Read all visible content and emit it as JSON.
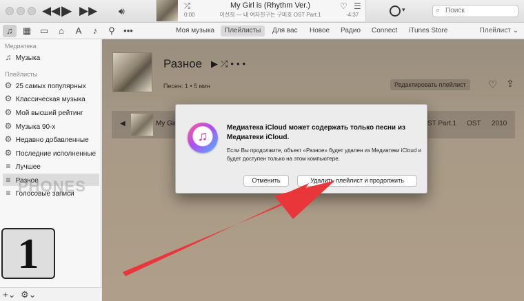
{
  "player": {
    "prev_icon": "rewind-icon",
    "play_icon": "play-icon",
    "next_icon": "fast-forward-icon",
    "volume_icon": "volume-icon",
    "now_playing": {
      "title": "My Girl is (Rhythm Ver.)",
      "artist_line": "이선희 — 내 여자친구는 구미호 OST Part.1",
      "elapsed": "0:00",
      "remaining": "-4:37",
      "progress_fraction": 0.0
    }
  },
  "search": {
    "placeholder": "Поиск"
  },
  "nav": {
    "tabs": [
      {
        "label": "Моя музыка"
      },
      {
        "label": "Плейлисты"
      },
      {
        "label": "Для вас"
      },
      {
        "label": "Новое"
      },
      {
        "label": "Радио"
      },
      {
        "label": "Connect"
      },
      {
        "label": "iTunes Store"
      }
    ],
    "active_tab": "Плейлисты",
    "view_select": "Плейлист"
  },
  "sidebar": {
    "library_header": "Медиатека",
    "library_items": [
      {
        "label": "Музыка",
        "icon": "music-note-icon"
      }
    ],
    "playlists_header": "Плейлисты",
    "playlist_items": [
      {
        "label": "25 самых популярных",
        "icon": "gear-icon"
      },
      {
        "label": "Классическая музыка",
        "icon": "gear-icon"
      },
      {
        "label": "Мой высший рейтинг",
        "icon": "gear-icon"
      },
      {
        "label": "Музыка 90-х",
        "icon": "gear-icon"
      },
      {
        "label": "Недавно добавленные",
        "icon": "gear-icon"
      },
      {
        "label": "Последние исполненные",
        "icon": "gear-icon"
      },
      {
        "label": "Лучшее",
        "icon": "playlist-icon"
      },
      {
        "label": "Разное",
        "icon": "playlist-icon"
      },
      {
        "label": "Голосовые записи",
        "icon": "playlist-icon"
      }
    ],
    "selected_playlist": "Разное"
  },
  "overlay": {
    "watermark": "PHONES",
    "step_number": "1"
  },
  "playlist": {
    "title": "Разное",
    "meta": "Песен: 1 • 5 мин",
    "edit_button": "Редактировать плейлист"
  },
  "track": {
    "name": "My Girl",
    "album": "ST Part.1",
    "genre": "OST",
    "year": "2010"
  },
  "dialog": {
    "title": "Медиатека iCloud может содержать только песни из Медиатеки iCloud.",
    "body": "Если Вы продолжите, объект «Разное» будет удален из Медиатеки iCloud и будет доступен только на этом компьютере.",
    "cancel_label": "Отменить",
    "confirm_label": "Удалить плейлист и продолжить"
  },
  "colors": {
    "arrow": "#e8363a",
    "dialog_bg": "#ececec",
    "main_bg": "#a89a86"
  }
}
